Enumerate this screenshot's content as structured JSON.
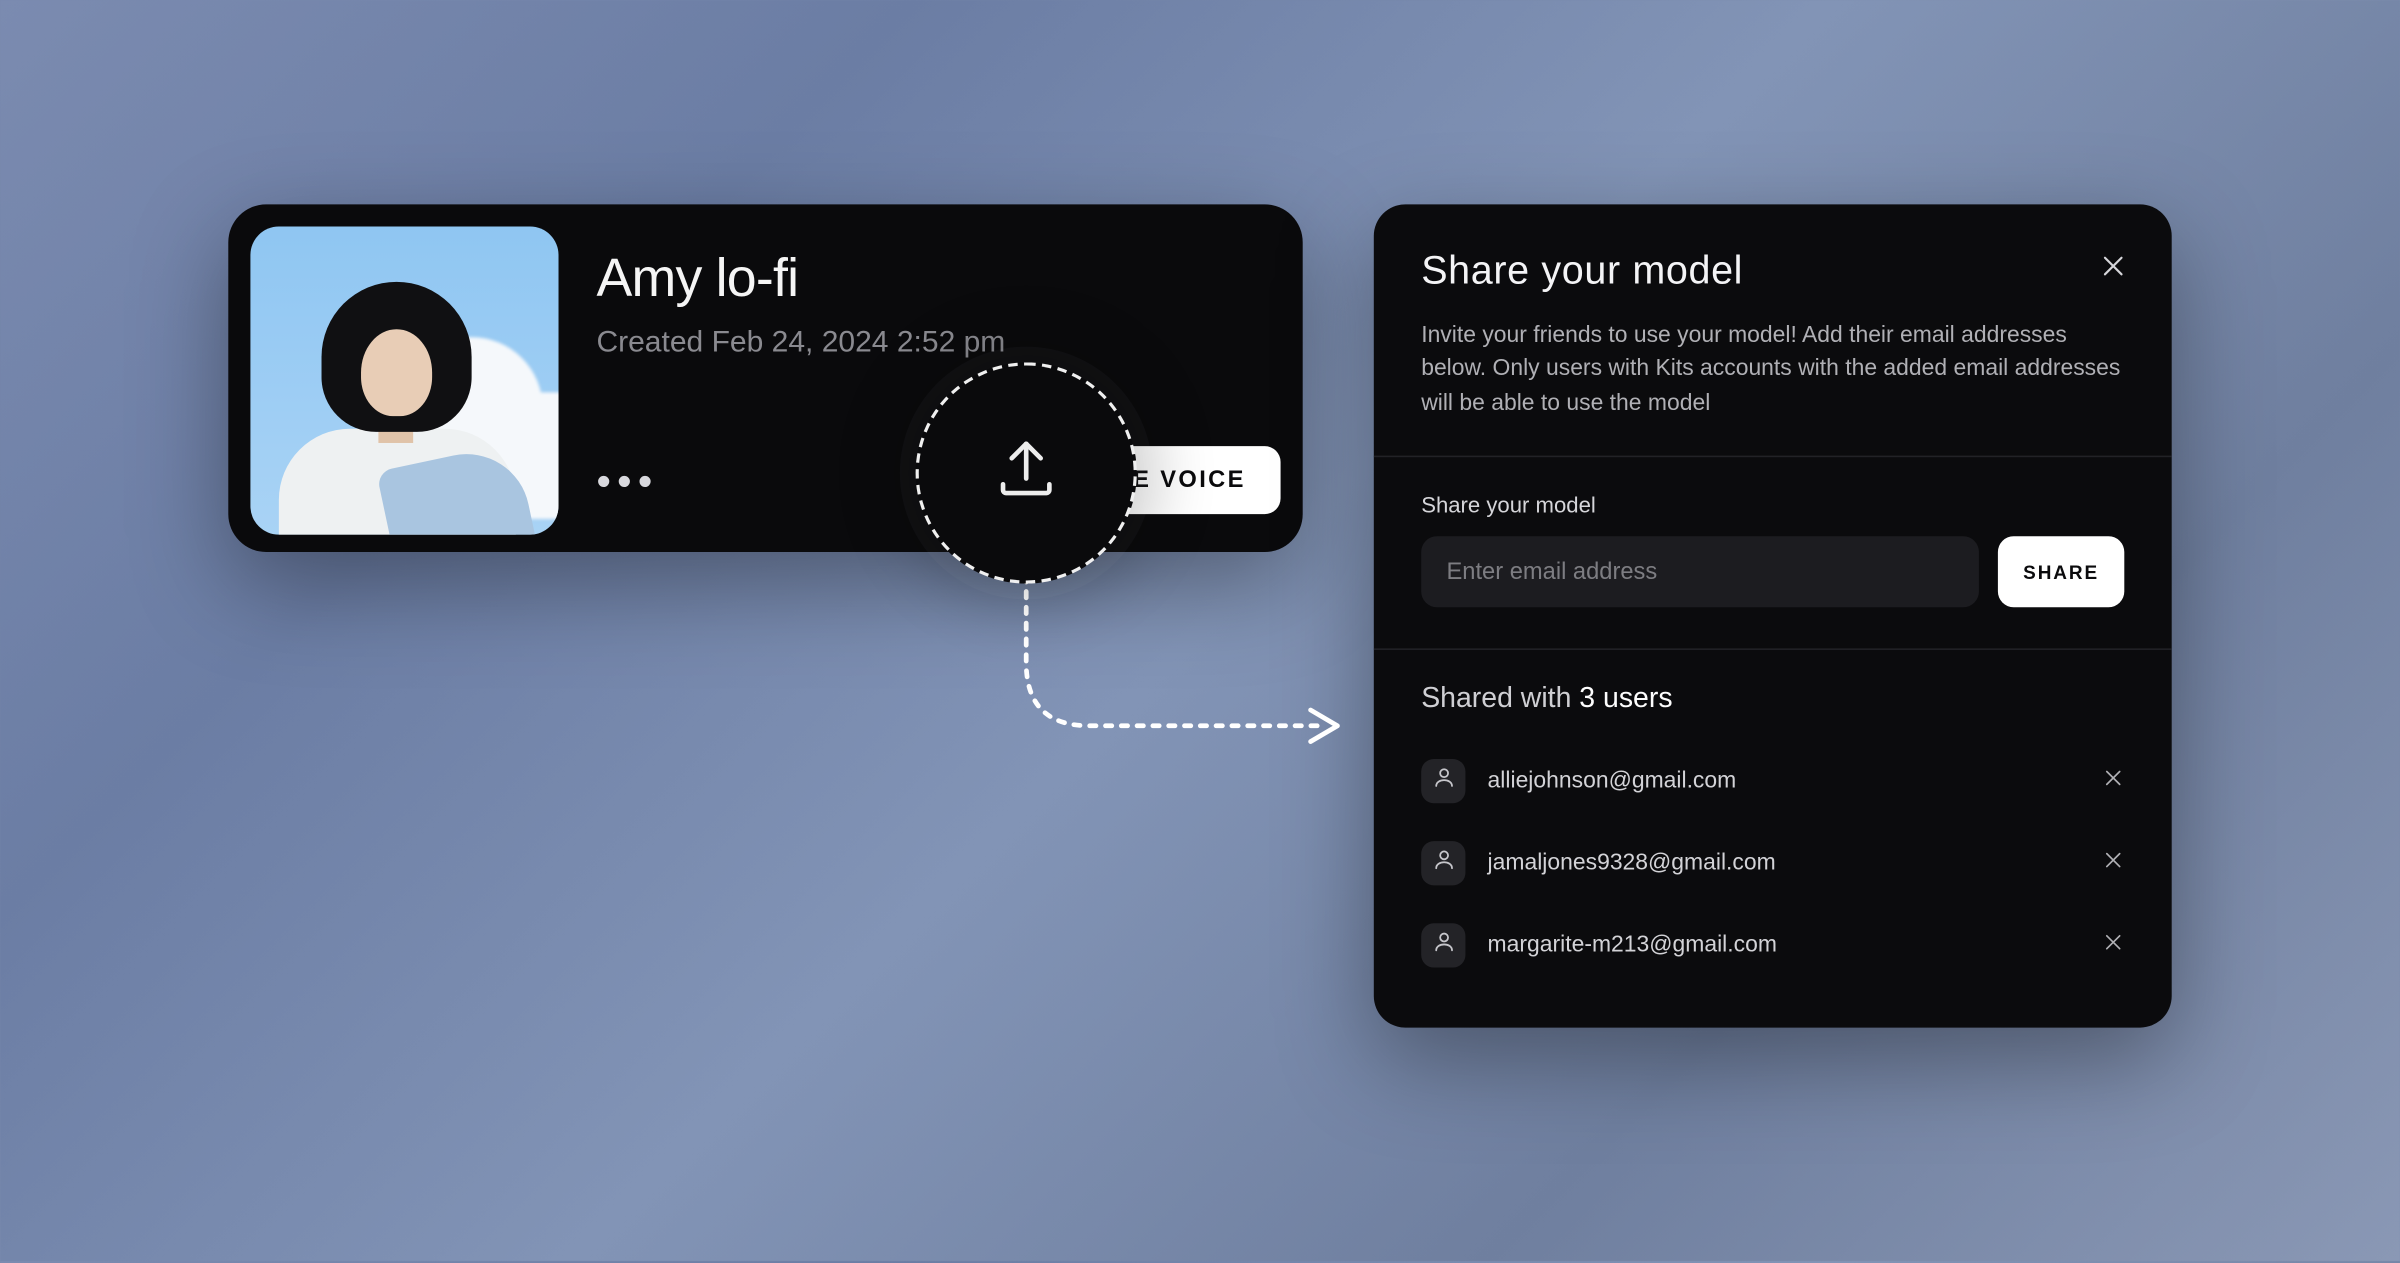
{
  "model": {
    "title": "Amy lo-fi",
    "created_label": "Created Feb 24, 2024 2:52 pm",
    "use_voice_label": "USE VOICE"
  },
  "share": {
    "title": "Share your model",
    "description": "Invite your friends to use your model! Add their email addresses below. Only users with Kits accounts with the added email addresses will be able to use the model",
    "form_label": "Share your model",
    "input_placeholder": "Enter email address",
    "button_label": "SHARE",
    "shared_with_prefix": "Shared with ",
    "shared_count": 3,
    "shared_count_text": "3 users",
    "users": [
      {
        "email": "alliejohnson@gmail.com"
      },
      {
        "email": "jamaljones9328@gmail.com"
      },
      {
        "email": "margarite-m213@gmail.com"
      }
    ]
  },
  "icons": {
    "upload": "upload-icon",
    "close": "close-icon",
    "user": "user-icon",
    "more": "more-horizontal-icon"
  },
  "colors": {
    "card_bg": "#0a0a0c",
    "modal_bg": "#0b0b0d",
    "text_primary": "#f5f5f5",
    "text_secondary": "#8a8a90",
    "button_bg": "#ffffff",
    "input_bg": "#1c1c20"
  }
}
